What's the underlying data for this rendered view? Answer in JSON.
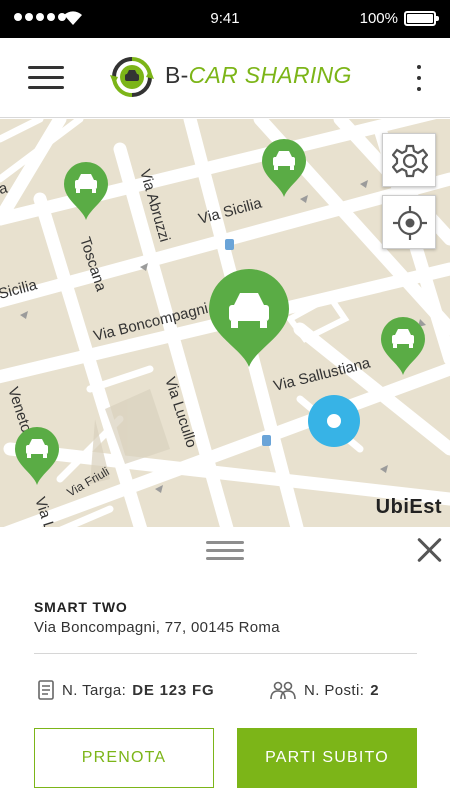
{
  "status_bar": {
    "time": "9:41",
    "battery": "100%",
    "icons": [
      "signal-dots-icon",
      "wifi-icon",
      "battery-icon"
    ]
  },
  "header": {
    "brand_prefix": "B-",
    "brand_accent": "CAR SHARING",
    "icons": [
      "menu-icon",
      "logo-car-icon",
      "more-vertical-icon"
    ]
  },
  "map": {
    "streets": [
      "Toscana",
      "Via Abruzzi",
      "Via Sicilia",
      "Sicilia",
      "Via Boncompagni",
      "Via Sallustiana",
      "Via Lucullo",
      "Veneto",
      "Via Friuli",
      "Via Leoni"
    ],
    "watermark": "UbiEst",
    "buttons": [
      "settings-gear-icon",
      "locate-crosshair-icon"
    ]
  },
  "vehicle": {
    "name": "SMART TWO",
    "address": "Via Boncompagni, 77, 00145 Roma",
    "plate_label": "N. Targa:",
    "plate_value": "DE 123 FG",
    "seats_label": "N. Posti:",
    "seats_value": "2"
  },
  "actions": {
    "book": "PRENOTA",
    "start": "PARTI SUBITO"
  },
  "colors": {
    "accent": "#7cb518",
    "pin": "#5aac45",
    "location": "#37b3e6",
    "map_bg": "#e8e1cf",
    "road": "#ffffff"
  }
}
